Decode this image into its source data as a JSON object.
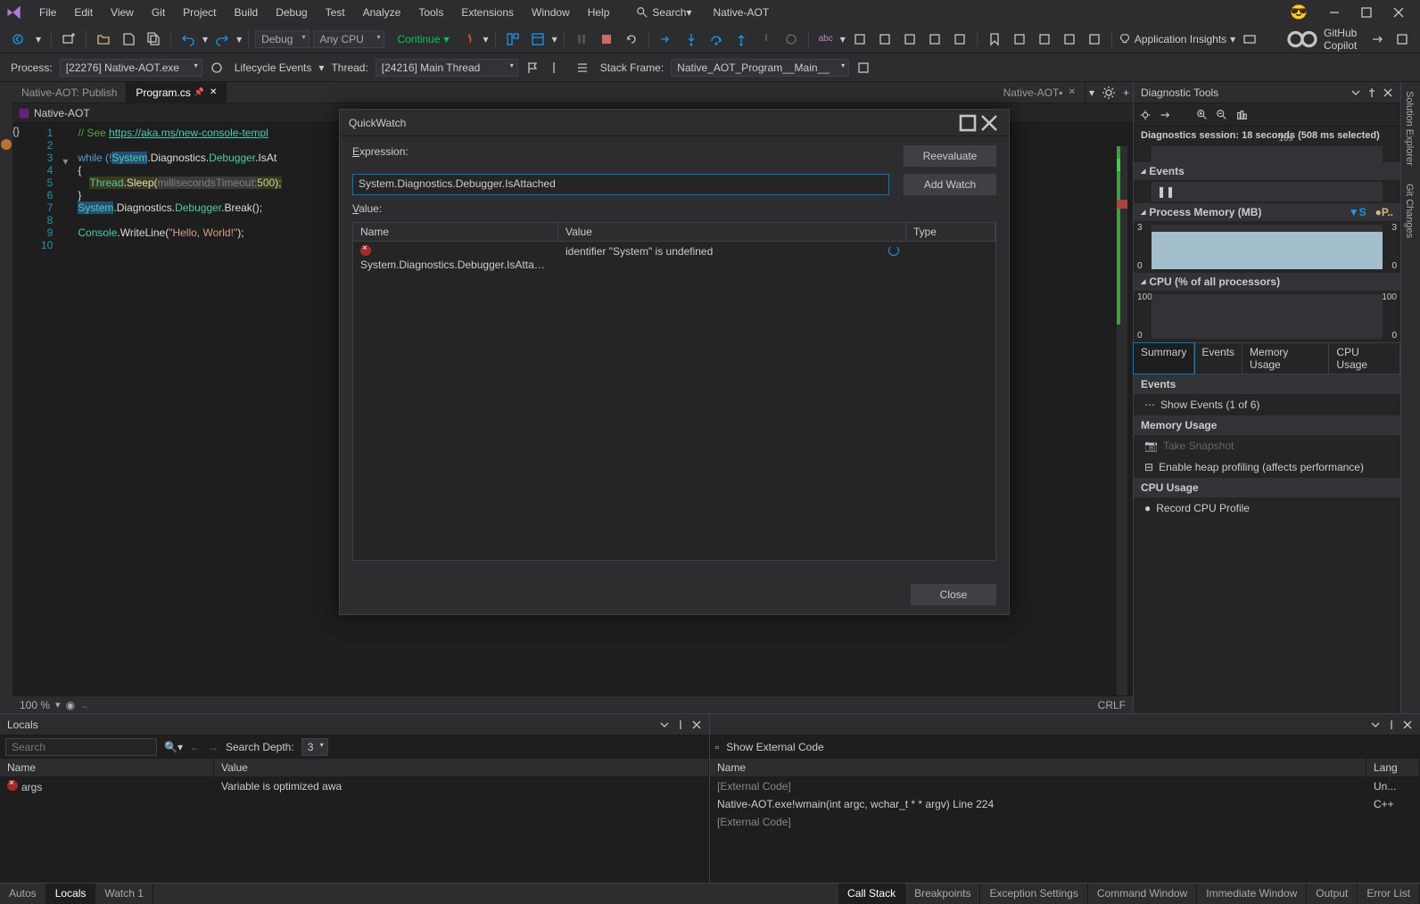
{
  "app_name": "Native-AOT",
  "menu": [
    "File",
    "Edit",
    "View",
    "Git",
    "Project",
    "Build",
    "Debug",
    "Test",
    "Analyze",
    "Tools",
    "Extensions",
    "Window",
    "Help"
  ],
  "search_label": "Search",
  "config_dropdown": "Debug",
  "platform_dropdown": "Any CPU",
  "continue_label": "Continue",
  "insights_label": "Application Insights",
  "copilot_label": "GitHub Copilot",
  "debug_bar": {
    "process_label": "Process:",
    "process_value": "[22276] Native-AOT.exe",
    "lifecycle": "Lifecycle Events",
    "thread_label": "Thread:",
    "thread_value": "[24216] Main Thread",
    "stack_label": "Stack Frame:",
    "stack_value": "Native_AOT_Program__Main__"
  },
  "doc_tabs": [
    {
      "label": "Native-AOT: Publish",
      "active": false
    },
    {
      "label": "Program.cs",
      "active": true
    }
  ],
  "sub_bar_project": "Native-AOT",
  "line_count": 10,
  "code_url": "https://aka.ms/new-console-templ",
  "code_lines": {
    "l1a": "// See ",
    "l1b": "https://aka.ms/new-console-templ",
    "l3": "while (!",
    "l3b": "System",
    "l3c": ".Diagnostics.",
    "l3d": "Debugger",
    "l3e": ".IsAt",
    "l4": "{",
    "l5a": "Thread",
    "l5b": ".Sleep(",
    "l5c": "millisecondsTimeout:",
    "l5d": "500",
    "l5e": ");",
    "l6": "}",
    "l7a": "System",
    "l7b": ".Diagnostics.",
    "l7c": "Debugger",
    "l7d": ".Break();",
    "l9a": "Console",
    "l9b": ".WriteLine(",
    "l9c": "\"Hello, World!\"",
    "l9d": ");"
  },
  "zoom": "100 %",
  "crlf": "CRLF",
  "right_doc_tab": "Native-AOT",
  "diagnostic": {
    "title": "Diagnostic Tools",
    "session": "Diagnostics session: 18 seconds (508 ms selected)",
    "time_mark": "10s",
    "events_label": "Events",
    "memory_label": "Process Memory (MB)",
    "memory_s": "S",
    "memory_p": "P..",
    "mem_max": "3",
    "mem_min": "0",
    "cpu_label": "CPU (% of all processors)",
    "cpu_max": "100",
    "cpu_min": "0",
    "tabs": [
      "Summary",
      "Events",
      "Memory Usage",
      "CPU Usage"
    ],
    "summary": {
      "events_hdr": "Events",
      "show_events": "Show Events (1 of 6)",
      "mem_hdr": "Memory Usage",
      "take_snapshot": "Take Snapshot",
      "heap_profiling": "Enable heap profiling (affects performance)",
      "cpu_hdr": "CPU Usage",
      "record_profile": "Record CPU Profile"
    }
  },
  "side_tabs": [
    "Solution Explorer",
    "Git Changes"
  ],
  "locals": {
    "title": "Locals",
    "search_placeholder": "Search",
    "depth_label": "Search Depth:",
    "depth_value": "3",
    "cols": [
      "Name",
      "Value"
    ],
    "row_name": "args",
    "row_value": "Variable is optimized awa"
  },
  "callstack": {
    "show_external": "Show External Code",
    "cols_name": "Name",
    "cols_lang": "Lang",
    "rows": [
      {
        "name": "[External Code]",
        "lang": "Un..."
      },
      {
        "name": "Native-AOT.exe!wmain(int argc, wchar_t * * argv) Line 224",
        "lang": "C++"
      },
      {
        "name": "[External Code]",
        "lang": ""
      }
    ]
  },
  "bottom_tabs_left": [
    "Autos",
    "Locals",
    "Watch 1"
  ],
  "bottom_tabs_right": [
    "Call Stack",
    "Breakpoints",
    "Exception Settings",
    "Command Window",
    "Immediate Window",
    "Output",
    "Error List"
  ],
  "quickwatch": {
    "title": "QuickWatch",
    "expression_label": "Expression:",
    "expression_value": "System.Diagnostics.Debugger.IsAttached",
    "value_label": "Value:",
    "reevaluate": "Reevaluate",
    "add_watch": "Add Watch",
    "close": "Close",
    "cols": [
      "Name",
      "Value",
      "Type"
    ],
    "row_name": "System.Diagnostics.Debugger.IsAtta…",
    "row_value": "identifier \"System\" is undefined"
  },
  "chart_data": [
    {
      "type": "area",
      "title": "Process Memory (MB)",
      "ylim": [
        0,
        3
      ],
      "x": [
        0,
        18
      ],
      "values": [
        3,
        3
      ]
    },
    {
      "type": "area",
      "title": "CPU (% of all processors)",
      "ylim": [
        0,
        100
      ],
      "x": [
        0,
        18
      ],
      "values": [
        0,
        0
      ]
    }
  ]
}
